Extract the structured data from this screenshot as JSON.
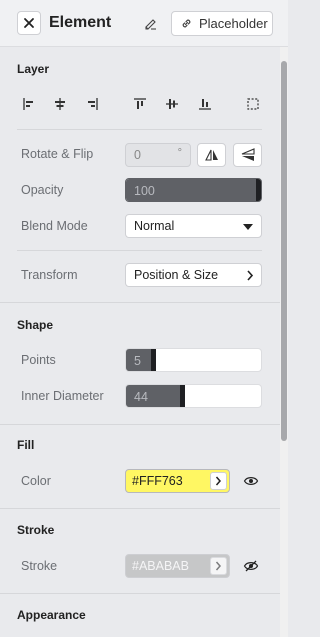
{
  "header": {
    "title": "Element",
    "placeholder_label": "Placeholder"
  },
  "layer": {
    "title": "Layer",
    "rotate_label": "Rotate & Flip",
    "rotate_value": "0",
    "rotate_unit": "°",
    "opacity_label": "Opacity",
    "opacity_value": "100",
    "opacity_fraction": 1.0,
    "blend_label": "Blend Mode",
    "blend_value": "Normal",
    "transform_label": "Transform",
    "transform_value": "Position & Size"
  },
  "shape": {
    "title": "Shape",
    "points_label": "Points",
    "points_value": "5",
    "points_fraction": 0.22,
    "inner_label": "Inner Diameter",
    "inner_value": "44",
    "inner_fraction": 0.44
  },
  "fill": {
    "title": "Fill",
    "color_label": "Color",
    "color_value": "#FFF763",
    "color_hex": "#FFF763",
    "visibility_icon": "eye-icon"
  },
  "stroke": {
    "title": "Stroke",
    "stroke_label": "Stroke",
    "stroke_value": "#ABABAB",
    "stroke_hex": "#ABABAB",
    "visibility_icon": "eye-off-icon"
  },
  "appearance": {
    "title": "Appearance"
  },
  "colors": {
    "panel_bg": "#e9eaed",
    "slider_fill": "#5f6166"
  }
}
